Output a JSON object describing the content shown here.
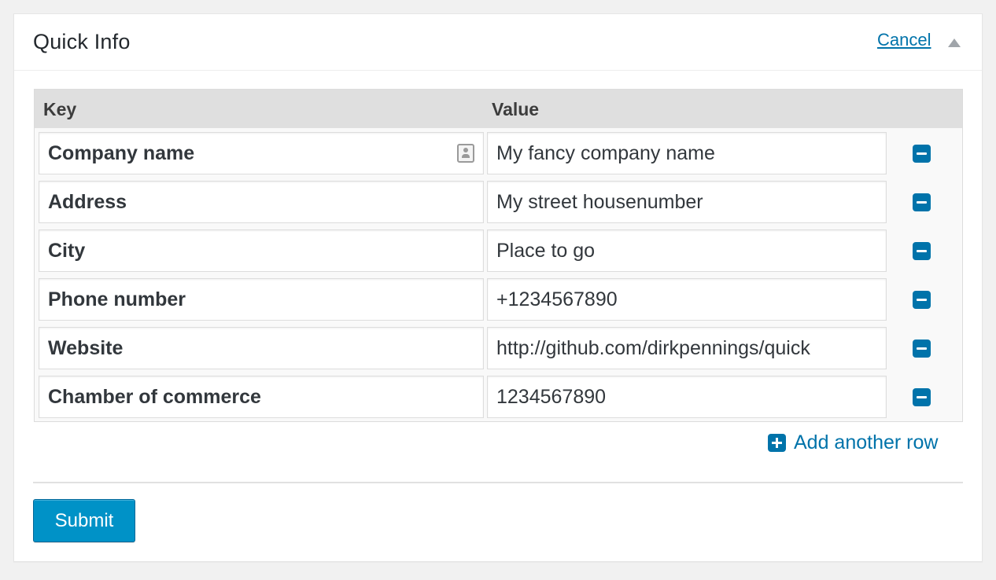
{
  "header": {
    "title": "Quick Info",
    "cancel_label": "Cancel",
    "collapse_icon": "triangle-up-icon"
  },
  "table": {
    "key_header": "Key",
    "value_header": "Value",
    "rows": [
      {
        "key": "Company name",
        "value": "My fancy company name"
      },
      {
        "key": "Address",
        "value": "My street housenumber"
      },
      {
        "key": "City",
        "value": "Place to go"
      },
      {
        "key": "Phone number",
        "value": "+1234567890"
      },
      {
        "key": "Website",
        "value": "http://github.com/dirkpennings/quick"
      },
      {
        "key": "Chamber of commerce",
        "value": "1234567890"
      }
    ],
    "remove_icon": "minus-square-icon",
    "contact_icon": "contact-card-icon"
  },
  "add_row": {
    "label": "Add another row",
    "icon": "plus-square-icon"
  },
  "submit_label": "Submit",
  "colors": {
    "accent": "#0073aa",
    "button": "#0092c7",
    "table_header_bg": "#dfdfdf",
    "page_bg": "#f1f1f1"
  }
}
